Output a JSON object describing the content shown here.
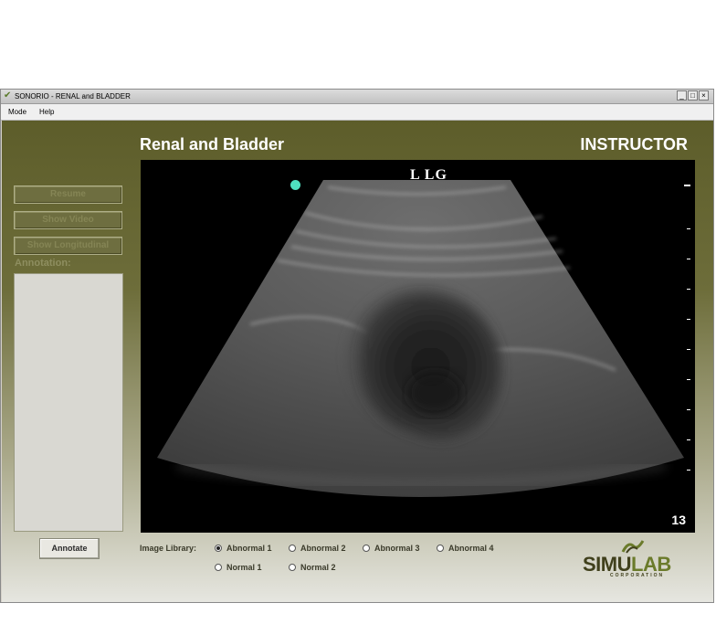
{
  "window": {
    "title": "SONORIO - RENAL and BLADDER",
    "controls": {
      "minimize": "_",
      "maximize": "□",
      "close": "×"
    }
  },
  "menu": {
    "items": [
      "Mode",
      "Help"
    ]
  },
  "header": {
    "title": "Renal and Bladder",
    "role": "INSTRUCTOR"
  },
  "sidebar": {
    "buttons": [
      {
        "label": "Resume"
      },
      {
        "label": "Show Video"
      },
      {
        "label": "Show Longitudinal"
      }
    ],
    "annotation_label": "Annotation:",
    "annotation_text": "",
    "annotate_button": "Annotate"
  },
  "ultrasound": {
    "label": "L  LG",
    "frame_number": "13",
    "marker_color": "#4fe0c0"
  },
  "image_library": {
    "label": "Image Library:",
    "options": [
      {
        "label": "Abnormal 1",
        "selected": true
      },
      {
        "label": "Abnormal 2",
        "selected": false
      },
      {
        "label": "Abnormal 3",
        "selected": false
      },
      {
        "label": "Abnormal 4",
        "selected": false
      },
      {
        "label": "Normal 1",
        "selected": false
      },
      {
        "label": "Normal 2",
        "selected": false
      }
    ]
  },
  "logo": {
    "text_a": "SIMU",
    "text_b": "LAB",
    "subtext": "CORPORATION"
  },
  "colors": {
    "panel": "#5d5d2a",
    "heading_text": "#ffffff",
    "accent": "#6b7b2b"
  }
}
